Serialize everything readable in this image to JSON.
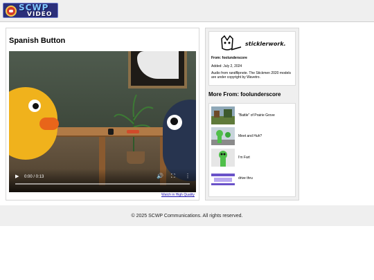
{
  "header": {
    "logo_text_top": "SCWP",
    "logo_text_bottom": "VIDEO"
  },
  "video": {
    "title": "Spanish Button",
    "time": "0:00 / 0:13",
    "play_icon": "play-icon",
    "hq_link": "Watch in High Quality"
  },
  "author": {
    "logo_text": "sticklerwork.xyz",
    "from": "From: foolunderscore",
    "added": "Added: July 2, 2024",
    "description": "Audio from randflipnote. The Stickmen 2020 models are under copyright by Wavetro."
  },
  "more": {
    "heading": "More From: foolunderscore",
    "items": [
      {
        "label": "\"Battle\" of Prairie Grove"
      },
      {
        "label": "Meet and Huh?"
      },
      {
        "label": "I'm Fart"
      },
      {
        "label": "drive thru"
      }
    ]
  },
  "footer": {
    "text": "© 2025 SCWP Communications. All rights reserved."
  },
  "colors": {
    "link": "#1a0dab",
    "panel_bg": "#efefef"
  }
}
